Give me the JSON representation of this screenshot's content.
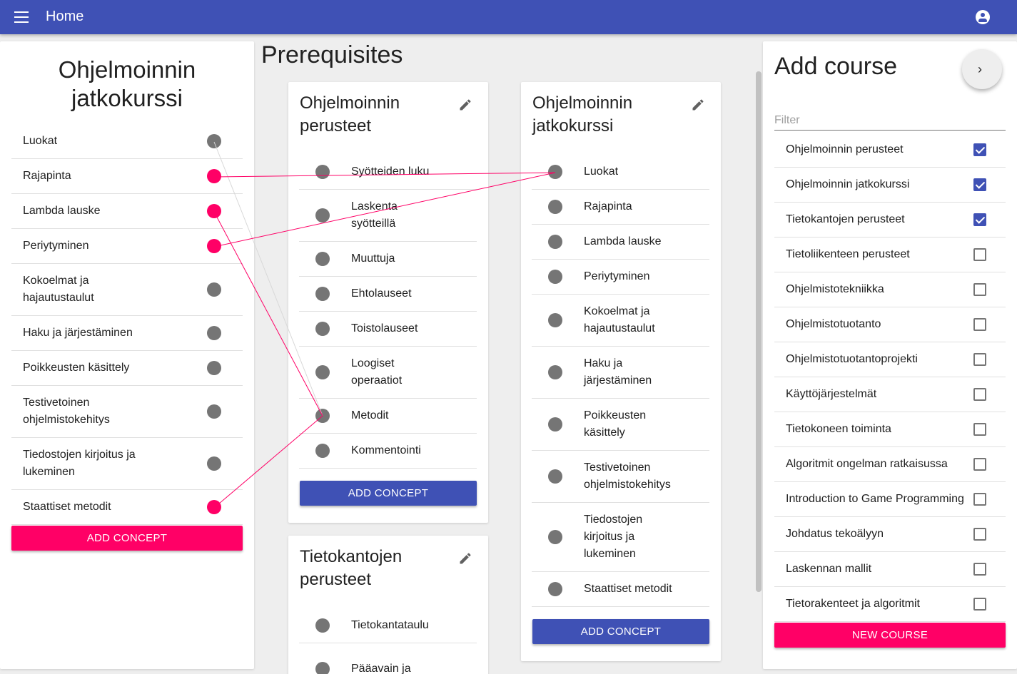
{
  "appbar": {
    "title": "Home",
    "menu_icon": "menu-icon",
    "account_icon": "account-icon"
  },
  "left_panel": {
    "title": "Ohjelmoinnin jatkokurssi",
    "concepts": [
      {
        "label": "Luokat",
        "active": false
      },
      {
        "label": "Rajapinta",
        "active": true
      },
      {
        "label": "Lambda lauske",
        "active": true
      },
      {
        "label": "Periytyminen",
        "active": true
      },
      {
        "label": "Kokoelmat ja hajautustaulut",
        "active": false
      },
      {
        "label": "Haku ja järjestäminen",
        "active": false
      },
      {
        "label": "Poikkeusten käsittely",
        "active": false
      },
      {
        "label": "Testivetoinen ohjelmistokehitys",
        "active": false
      },
      {
        "label": "Tiedostojen kirjoitus ja lukeminen",
        "active": false
      },
      {
        "label": "Staattiset metodit",
        "active": true
      }
    ],
    "add_button": "ADD CONCEPT"
  },
  "prerequisites": {
    "title": "Prerequisites",
    "courses": [
      {
        "name": "Ohjelmoinnin perusteet",
        "concepts": [
          "Syötteiden luku",
          "Laskenta syötteillä",
          "Muuttuja",
          "Ehtolauseet",
          "Toistolauseet",
          "Loogiset operaatiot",
          "Metodit",
          "Kommentointi"
        ],
        "add_button": "ADD CONCEPT"
      },
      {
        "name": "Ohjelmoinnin jatkokurssi",
        "concepts": [
          "Luokat",
          "Rajapinta",
          "Lambda lauske",
          "Periytyminen",
          "Kokoelmat ja hajautustaulut",
          "Haku ja järjestäminen",
          "Poikkeusten käsittely",
          "Testivetoinen ohjelmistokehitys",
          "Tiedostojen kirjoitus ja lukeminen",
          "Staattiset metodit"
        ],
        "add_button": "ADD CONCEPT"
      },
      {
        "name": "Tietokantojen perusteet",
        "concepts": [
          "Tietokantataulu",
          "Pääavain ja"
        ]
      }
    ]
  },
  "add_course": {
    "title": "Add course",
    "fab_icon": "chevron-right-icon",
    "filter_placeholder": "Filter",
    "courses": [
      {
        "label": "Ohjelmoinnin perusteet",
        "checked": true
      },
      {
        "label": "Ohjelmoinnin jatkokurssi",
        "checked": true
      },
      {
        "label": "Tietokantojen perusteet",
        "checked": true
      },
      {
        "label": "Tietoliikenteen perusteet",
        "checked": false
      },
      {
        "label": "Ohjelmistotekniikka",
        "checked": false
      },
      {
        "label": "Ohjelmistotuotanto",
        "checked": false
      },
      {
        "label": "Ohjelmistotuotantoprojekti",
        "checked": false
      },
      {
        "label": "Käyttöjärjestelmät",
        "checked": false
      },
      {
        "label": "Tietokoneen toiminta",
        "checked": false
      },
      {
        "label": "Algoritmit ongelman ratkaisussa",
        "checked": false
      },
      {
        "label": "Introduction to Game Programming",
        "checked": false
      },
      {
        "label": "Johdatus tekoälyyn",
        "checked": false
      },
      {
        "label": "Laskennan mallit",
        "checked": false
      },
      {
        "label": "Tietorakenteet ja algoritmit",
        "checked": false
      }
    ],
    "new_course_button": "NEW COURSE"
  },
  "colors": {
    "primary": "#3f51b5",
    "accent": "#ff0066",
    "link_line": "#ff0066",
    "inactive_dot": "#757575"
  }
}
